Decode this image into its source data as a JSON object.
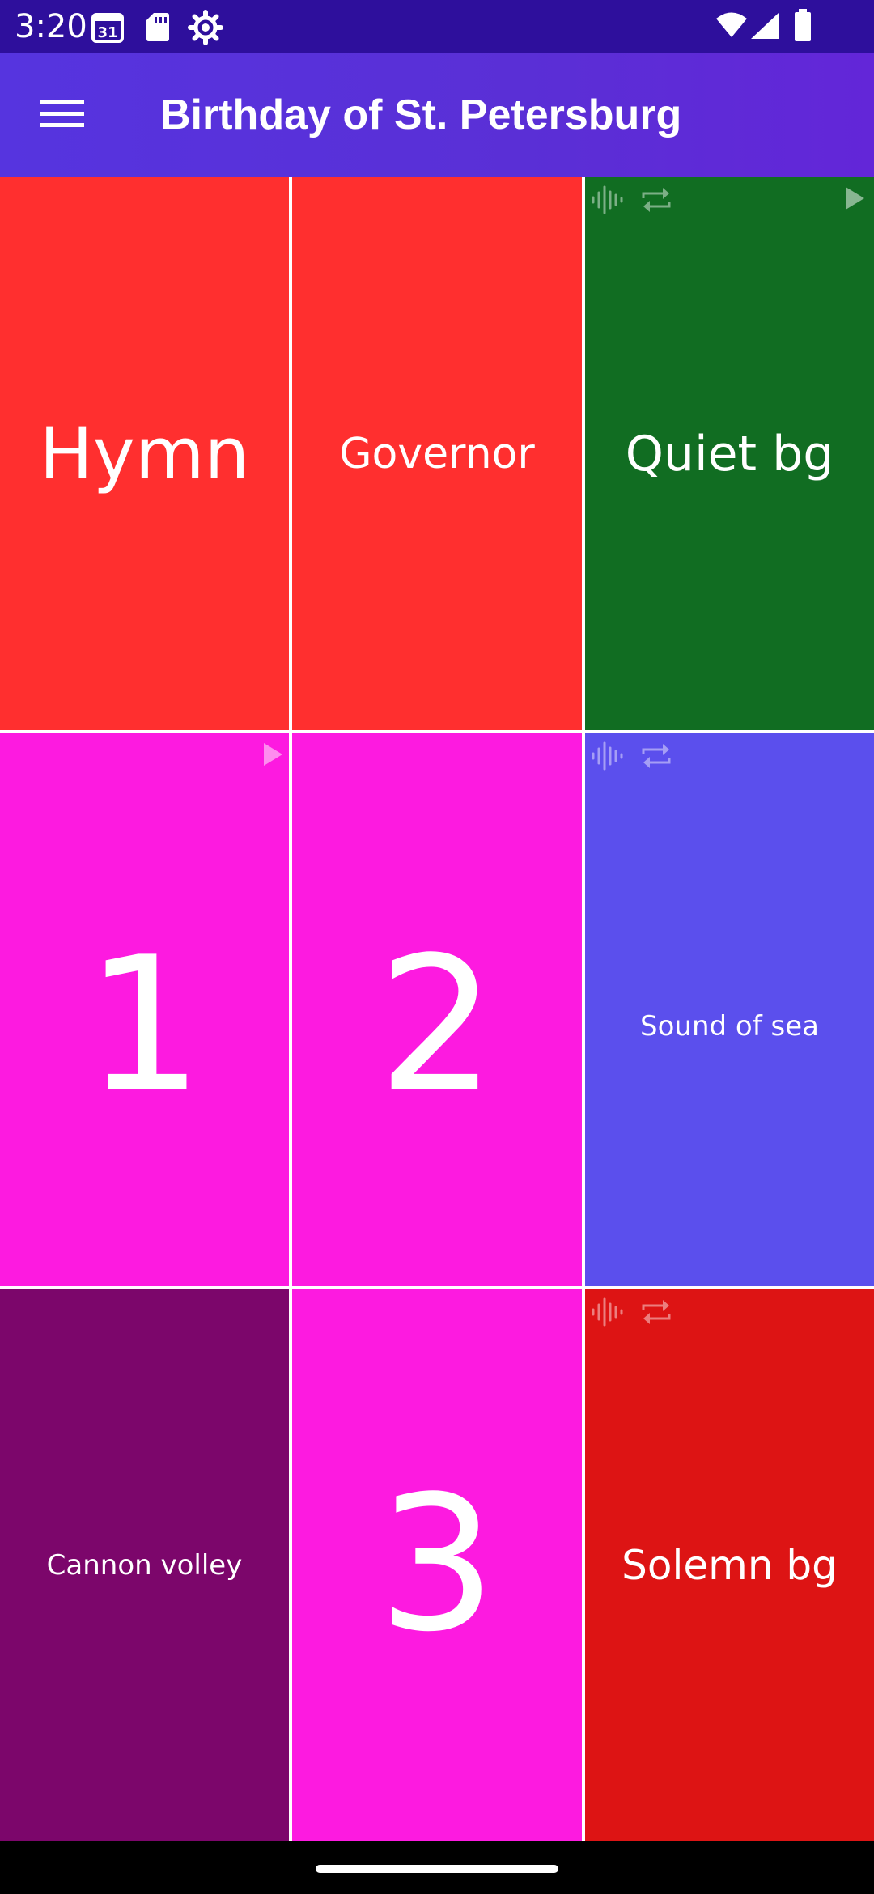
{
  "status_bar": {
    "time": "3:20",
    "calendar_day": "31",
    "icons": [
      "calendar-icon",
      "sd-card-icon",
      "settings-icon",
      "wifi-icon",
      "signal-icon",
      "battery-icon"
    ]
  },
  "app_bar": {
    "title": "Birthday of St. Petersburg",
    "menu_icon": "menu-icon"
  },
  "tiles": [
    {
      "label": "Hymn",
      "color": "#ff2f2f",
      "playing": false,
      "loop": false
    },
    {
      "label": "Governor",
      "color": "#ff2f2f",
      "playing": false,
      "loop": false
    },
    {
      "label": "Quiet bg",
      "color": "#116d22",
      "playing": true,
      "loop": true
    },
    {
      "label": "1",
      "color": "#fd1ae0",
      "playing": true,
      "loop": false
    },
    {
      "label": "2",
      "color": "#fd1ae0",
      "playing": false,
      "loop": false
    },
    {
      "label": "Sound of sea",
      "color": "#5b4fed",
      "playing": false,
      "loop": true
    },
    {
      "label": "Cannon volley",
      "color": "#7c066b",
      "playing": false,
      "loop": false
    },
    {
      "label": "3",
      "color": "#fd1ae0",
      "playing": false,
      "loop": false
    },
    {
      "label": "Solemn bg",
      "color": "#dd1414",
      "playing": false,
      "loop": true
    }
  ],
  "colors": {
    "status_bar": "#2e0f9c",
    "app_bar": "#5a2fd6",
    "nav_bar": "#000000"
  }
}
